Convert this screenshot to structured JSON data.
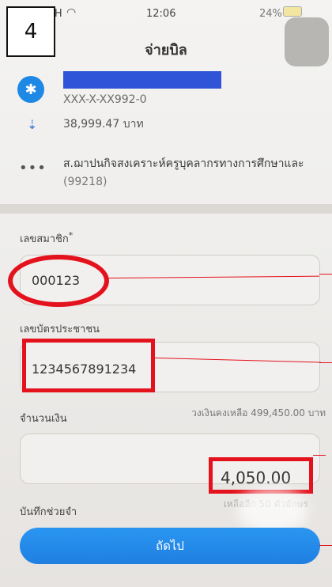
{
  "annotation": {
    "step": "4"
  },
  "status_bar": {
    "carrier": "E-H",
    "time": "12:06",
    "battery": "24%"
  },
  "screen": {
    "title": "จ่ายบิล"
  },
  "from_account": {
    "account_number": "XXX-X-XX992-0",
    "balance": "38,999.47 บาท"
  },
  "payee": {
    "name": "ส.ฌาปนกิจสงเคราะห์ครูบุคลากรทางการศึกษาและ",
    "code": "(99218)"
  },
  "form": {
    "member_no": {
      "label": "เลขสมาชิก",
      "required_mark": "*",
      "value": "000123"
    },
    "citizen_id": {
      "label": "เลขบัตรประชาชน",
      "value": "1234567891234"
    },
    "amount": {
      "label": "จำนวนเงิน",
      "limit_note": "วงเงินคงเหลือ 499,450.00 บาท",
      "value": "4,050.00"
    },
    "memo": {
      "label": "บันทึกช่วยจำ",
      "remaining_note": "เหลืออีก 50 ตัวอักษร"
    }
  },
  "actions": {
    "next_label": "ถัดไป"
  },
  "colors": {
    "accent": "#1f7fe0",
    "highlight": "#e3121c",
    "redaction": "#2f54d8"
  },
  "icons": [
    "wifi-icon",
    "bank-logo-icon",
    "arrow-down-icon",
    "more-icon"
  ]
}
